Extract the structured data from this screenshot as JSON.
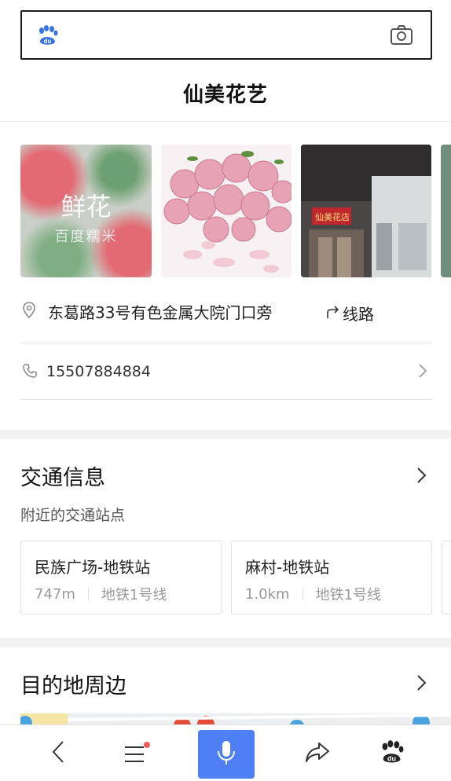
{
  "search": {
    "placeholder": ""
  },
  "page": {
    "title": "仙美花艺"
  },
  "photos": [
    {
      "label": "鲜花",
      "sub": "百度糯米"
    },
    {
      "label": ""
    },
    {
      "label": "仙美花店"
    }
  ],
  "info": {
    "address": "东葛路33号有色金属大院门口旁",
    "route_label": "线路",
    "phone": "15507884884"
  },
  "transport": {
    "title": "交通信息",
    "subtitle": "附近的交通站点",
    "stations": [
      {
        "name": "民族广场-地铁站",
        "distance": "747m",
        "line": "地铁1号线"
      },
      {
        "name": "麻村-地铁站",
        "distance": "1.0km",
        "line": "地铁1号线"
      }
    ]
  },
  "nearby": {
    "title": "目的地周边"
  },
  "colors": {
    "accent": "#4e7ff5",
    "badge": "#f25c54",
    "divider": "#e6e6e6"
  },
  "icons": [
    "baidu-paw-icon",
    "camera-icon",
    "location-pin-icon",
    "route-icon",
    "phone-icon",
    "chevron-right-icon",
    "back-icon",
    "menu-icon",
    "mic-icon",
    "share-icon"
  ]
}
